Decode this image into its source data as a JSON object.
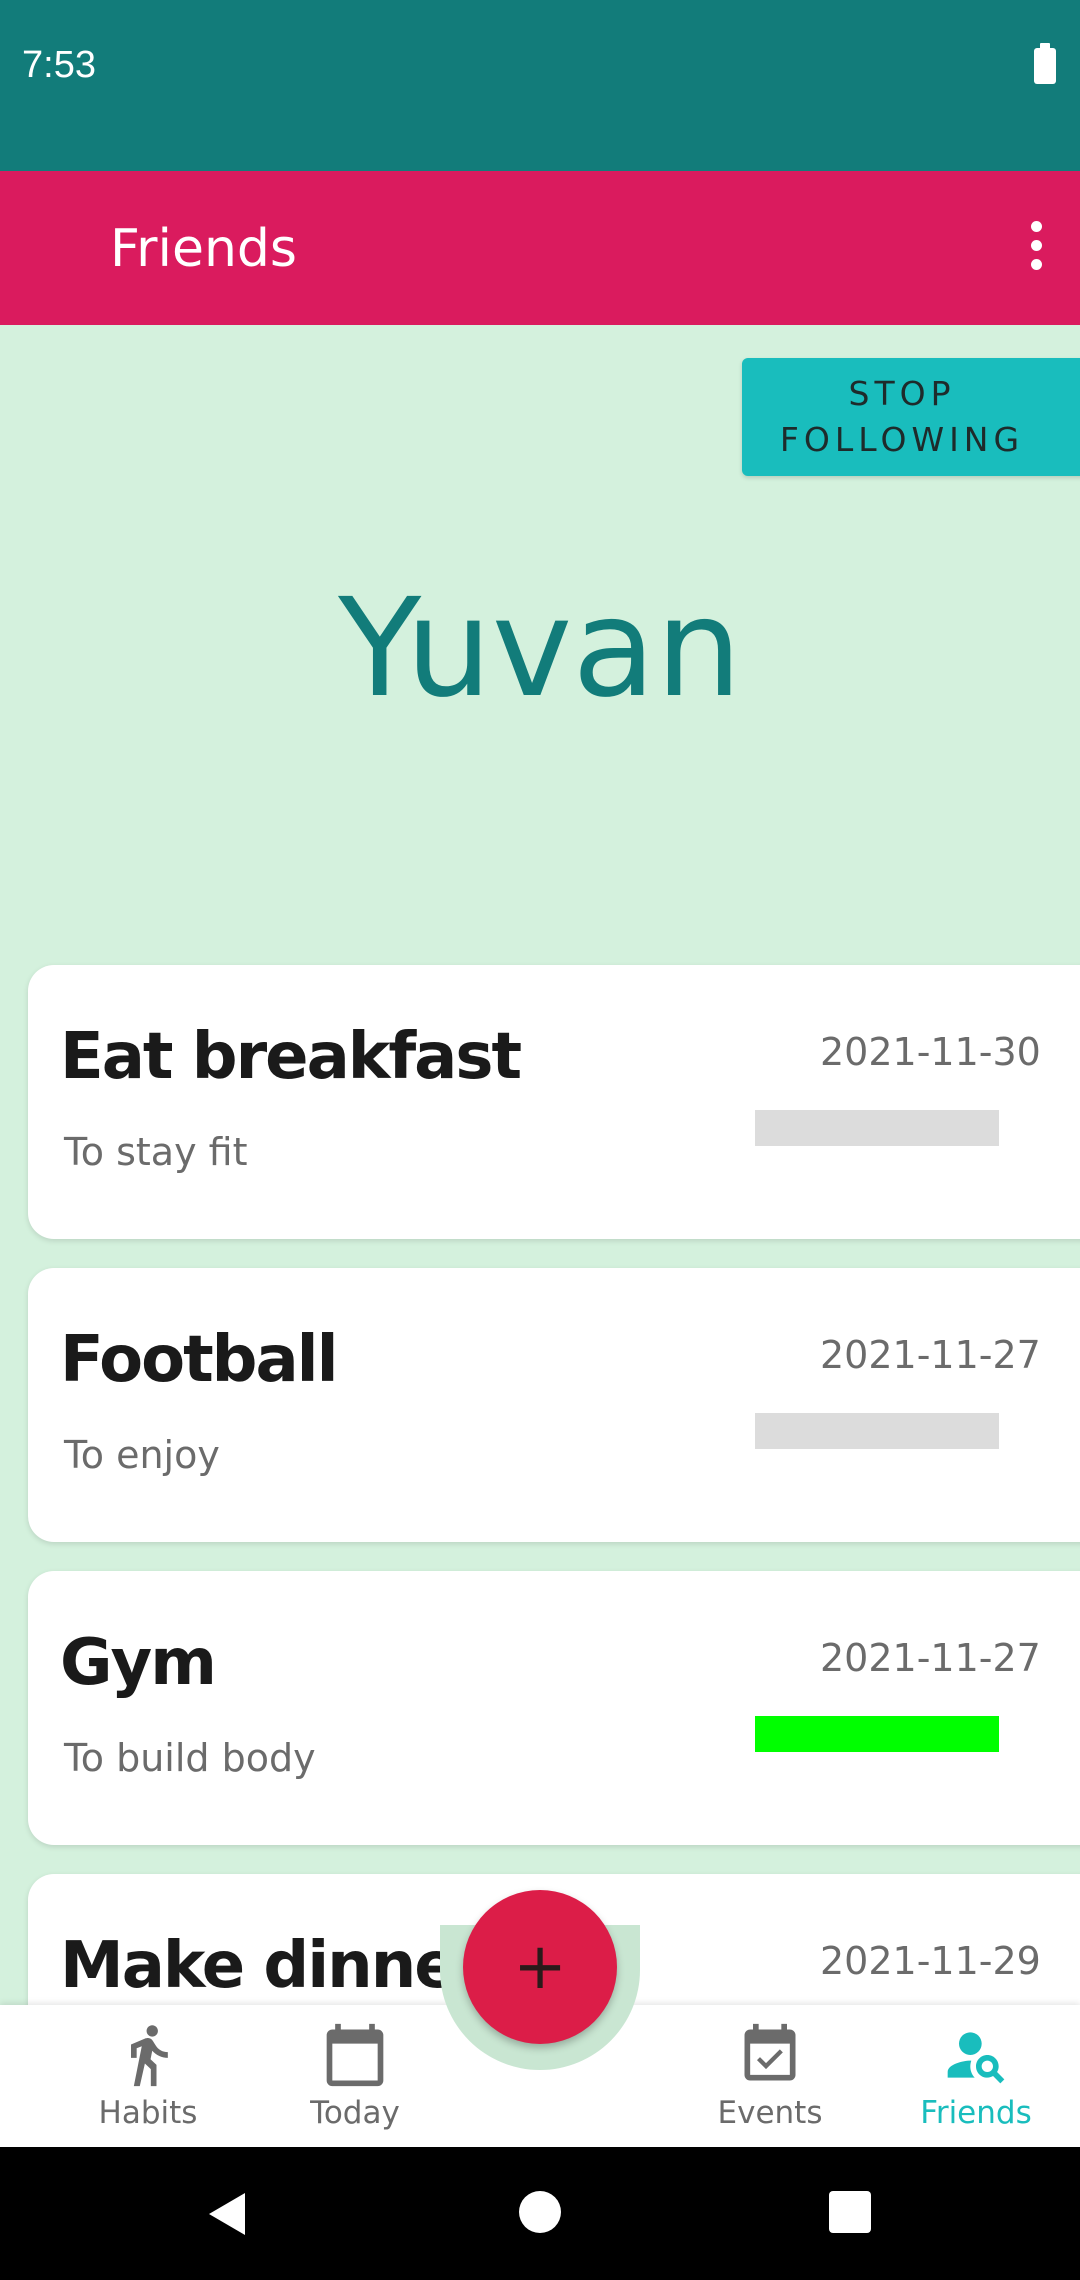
{
  "status_bar": {
    "time": "7:53",
    "battery_icon": "battery-icon"
  },
  "app_bar": {
    "title": "Friends",
    "menu_icon": "more-vert-icon"
  },
  "profile": {
    "stop_following_label": "STOP FOLLOWING",
    "username": "Yuvan"
  },
  "habits": [
    {
      "title": "Eat breakfast",
      "subtitle": "To stay fit",
      "date": "2021-11-30",
      "progress": 0,
      "progress_color": "#dcdcdc"
    },
    {
      "title": "Football",
      "subtitle": "To enjoy",
      "date": "2021-11-27",
      "progress": 0,
      "progress_color": "#dcdcdc"
    },
    {
      "title": "Gym",
      "subtitle": "To build body",
      "date": "2021-11-27",
      "progress": 1,
      "progress_color": "#00ff00"
    },
    {
      "title": "Make dinner",
      "subtitle": "",
      "date": "2021-11-29",
      "progress": 0,
      "progress_color": "#dcdcdc"
    }
  ],
  "fab": {
    "label": "+",
    "icon": "plus-icon"
  },
  "bottom_nav": {
    "items": [
      {
        "label": "Habits",
        "icon": "running-person-icon",
        "active": false
      },
      {
        "label": "Today",
        "icon": "calendar-icon",
        "active": false
      },
      {
        "label": "Events",
        "icon": "calendar-check-icon",
        "active": false
      },
      {
        "label": "Friends",
        "icon": "person-search-icon",
        "active": true
      }
    ]
  },
  "colors": {
    "status_bar": "#127c7a",
    "app_bar": "#da1b5e",
    "background": "#d4f1dd",
    "accent": "#19bdbd",
    "fab": "#dc1d48",
    "username": "#127c7a"
  }
}
